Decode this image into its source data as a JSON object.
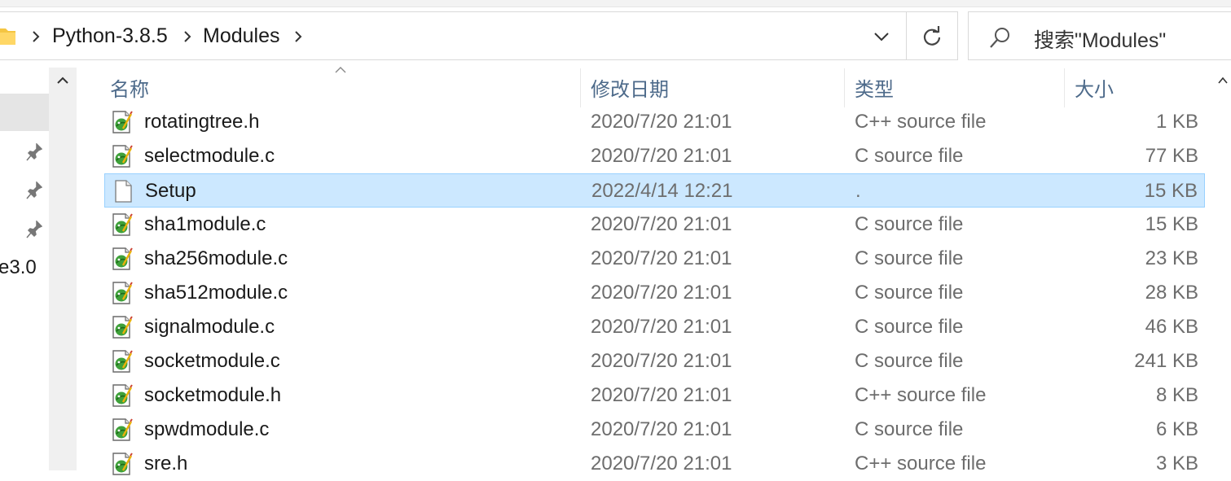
{
  "breadcrumb": [
    "Python-3.8.5",
    "Modules"
  ],
  "search": {
    "placeholder": "搜索\"Modules\""
  },
  "nav": {
    "truncated_item": "e3.0"
  },
  "columns": {
    "name": "名称",
    "date": "修改日期",
    "type": "类型",
    "size": "大小"
  },
  "files": [
    {
      "name": "rotatingtree.h",
      "date": "2020/7/20 21:01",
      "type": "C++ source file",
      "size": "1 KB",
      "icon": "source-file-icon",
      "selected": false
    },
    {
      "name": "selectmodule.c",
      "date": "2020/7/20 21:01",
      "type": "C source file",
      "size": "77 KB",
      "icon": "source-file-icon",
      "selected": false
    },
    {
      "name": "Setup",
      "date": "2022/4/14 12:21",
      "type": ".",
      "size": "15 KB",
      "icon": "blank-file-icon",
      "selected": true
    },
    {
      "name": "sha1module.c",
      "date": "2020/7/20 21:01",
      "type": "C source file",
      "size": "15 KB",
      "icon": "source-file-icon",
      "selected": false
    },
    {
      "name": "sha256module.c",
      "date": "2020/7/20 21:01",
      "type": "C source file",
      "size": "23 KB",
      "icon": "source-file-icon",
      "selected": false
    },
    {
      "name": "sha512module.c",
      "date": "2020/7/20 21:01",
      "type": "C source file",
      "size": "28 KB",
      "icon": "source-file-icon",
      "selected": false
    },
    {
      "name": "signalmodule.c",
      "date": "2020/7/20 21:01",
      "type": "C source file",
      "size": "46 KB",
      "icon": "source-file-icon",
      "selected": false
    },
    {
      "name": "socketmodule.c",
      "date": "2020/7/20 21:01",
      "type": "C source file",
      "size": "241 KB",
      "icon": "source-file-icon",
      "selected": false
    },
    {
      "name": "socketmodule.h",
      "date": "2020/7/20 21:01",
      "type": "C++ source file",
      "size": "8 KB",
      "icon": "source-file-icon",
      "selected": false
    },
    {
      "name": "spwdmodule.c",
      "date": "2020/7/20 21:01",
      "type": "C source file",
      "size": "6 KB",
      "icon": "source-file-icon",
      "selected": false
    },
    {
      "name": "sre.h",
      "date": "2020/7/20 21:01",
      "type": "C++ source file",
      "size": "3 KB",
      "icon": "source-file-icon",
      "selected": false
    }
  ],
  "colors": {
    "selection": "#cce8ff",
    "selection_border": "#99d1ff",
    "header_text": "#4d6a8a",
    "secondary_text": "#6d6d6d"
  }
}
